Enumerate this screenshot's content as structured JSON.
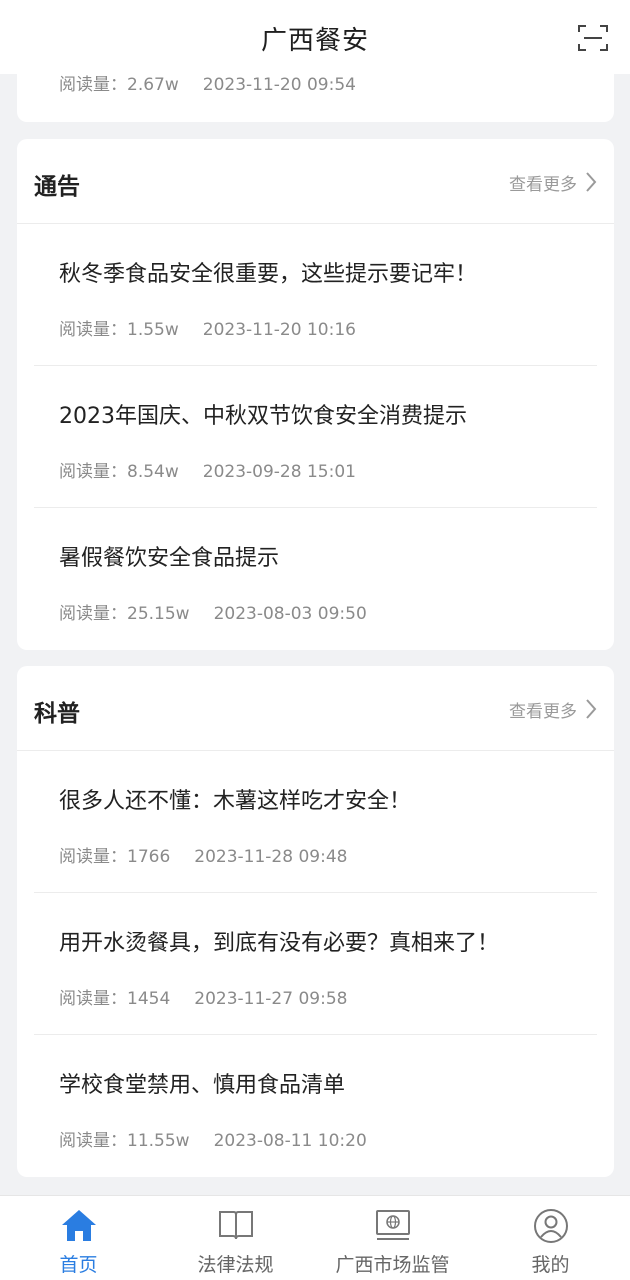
{
  "header": {
    "title": "广西餐安"
  },
  "top_item": {
    "reads": "阅读量：2.67w",
    "time": "2023-11-20 09:54"
  },
  "sections": [
    {
      "title": "通告",
      "more_label": "查看更多",
      "articles": [
        {
          "title": "秋冬季食品安全很重要，这些提示要记牢！",
          "reads": "阅读量：1.55w",
          "time": "2023-11-20 10:16"
        },
        {
          "title": "2023年国庆、中秋双节饮食安全消费提示",
          "reads": "阅读量：8.54w",
          "time": "2023-09-28 15:01"
        },
        {
          "title": "暑假餐饮安全食品提示",
          "reads": "阅读量：25.15w",
          "time": "2023-08-03 09:50"
        }
      ]
    },
    {
      "title": "科普",
      "more_label": "查看更多",
      "articles": [
        {
          "title": "很多人还不懂：木薯这样吃才安全！",
          "reads": "阅读量：1766",
          "time": "2023-11-28 09:48"
        },
        {
          "title": "用开水烫餐具，到底有没有必要？真相来了！",
          "reads": "阅读量：1454",
          "time": "2023-11-27 09:58"
        },
        {
          "title": "学校食堂禁用、慎用食品清单",
          "reads": "阅读量：11.55w",
          "time": "2023-08-11 10:20"
        }
      ]
    }
  ],
  "tabbar": {
    "items": [
      {
        "label": "首页",
        "icon": "home-icon",
        "active": true
      },
      {
        "label": "法律法规",
        "icon": "book-icon",
        "active": false
      },
      {
        "label": "广西市场监管",
        "icon": "monitor-icon",
        "active": false
      },
      {
        "label": "我的",
        "icon": "user-icon",
        "active": false
      }
    ]
  },
  "colors": {
    "accent": "#2a7de1",
    "background": "#f1f2f4",
    "muted_text": "#8a8a8a"
  }
}
